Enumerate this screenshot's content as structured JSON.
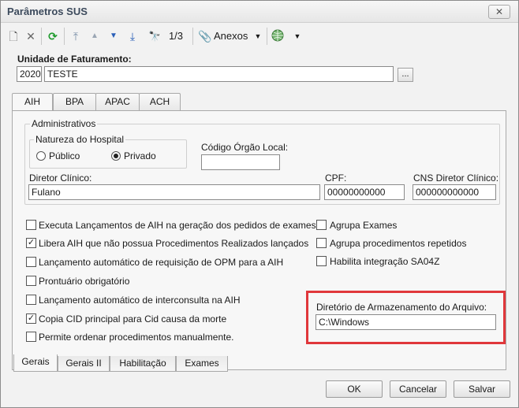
{
  "window": {
    "title": "Parâmetros SUS",
    "close_glyph": "✕"
  },
  "toolbar": {
    "items": [
      {
        "icon": "new-document-icon",
        "glyph": "🗋"
      },
      {
        "icon": "delete-icon",
        "glyph": "✕"
      },
      {
        "icon": "refresh-icon",
        "glyph": "⟳"
      },
      {
        "icon": "first-record-icon",
        "glyph": "⤒"
      },
      {
        "icon": "previous-record-icon",
        "glyph": "▲"
      },
      {
        "icon": "next-record-icon",
        "glyph": "▼"
      },
      {
        "icon": "last-record-icon",
        "glyph": "⤓"
      },
      {
        "icon": "search-binoculars-icon",
        "glyph": "🔭"
      }
    ],
    "record_counter": "1/3",
    "attachments_label": "Anexos",
    "attachments_icon": "paperclip-icon",
    "globe_icon": "globe-icon",
    "dropdown_glyph": "▼"
  },
  "unit": {
    "label": "Unidade de Faturamento:",
    "code": "2020",
    "name": "TESTE",
    "browse_label": "..."
  },
  "tabs": [
    {
      "label": "AIH",
      "active": true
    },
    {
      "label": "BPA",
      "active": false
    },
    {
      "label": "APAC",
      "active": false
    },
    {
      "label": "ACH",
      "active": false
    }
  ],
  "admin": {
    "group_title": "Administrativos",
    "nature_title": "Natureza do Hospital",
    "radio_public": "Público",
    "radio_private": "Privado",
    "selected": "Privado",
    "org_code_label": "Código Órgão Local:",
    "org_code_value": "",
    "director_label": "Diretor Clínico:",
    "director_value": "Fulano",
    "cpf_label": "CPF:",
    "cpf_value": "00000000000",
    "cns_label": "CNS Diretor Clínico:",
    "cns_value": "000000000000"
  },
  "options_left": [
    {
      "label": "Executa Lançamentos de AIH na geração dos pedidos de exames?",
      "checked": false
    },
    {
      "label": "Libera AIH que não possua Procedimentos Realizados lançados",
      "checked": true
    },
    {
      "label": "Lançamento automático de requisição de OPM para a AIH",
      "checked": false
    },
    {
      "label": "Prontuário obrigatório",
      "checked": false
    },
    {
      "label": "Lançamento automático de interconsulta na AIH",
      "checked": false
    },
    {
      "label": "Copia CID principal para Cid causa da morte",
      "checked": true
    },
    {
      "label": "Permite ordenar procedimentos manualmente.",
      "checked": false
    }
  ],
  "options_right": [
    {
      "label": "Agrupa Exames",
      "checked": false
    },
    {
      "label": "Agrupa procedimentos repetidos",
      "checked": false
    },
    {
      "label": "Habilita integração SA04Z",
      "checked": false
    }
  ],
  "storage": {
    "label": "Diretório de Armazenamento do Arquivo:",
    "value": "C:\\Windows",
    "highlight_color": "#e0373b"
  },
  "bottom_tabs": [
    {
      "label": "Gerais",
      "active": true
    },
    {
      "label": "Gerais II",
      "active": false
    },
    {
      "label": "Habilitação",
      "active": false
    },
    {
      "label": "Exames",
      "active": false
    }
  ],
  "buttons": {
    "ok": "OK",
    "cancel": "Cancelar",
    "save": "Salvar"
  },
  "check_glyph": "✓"
}
